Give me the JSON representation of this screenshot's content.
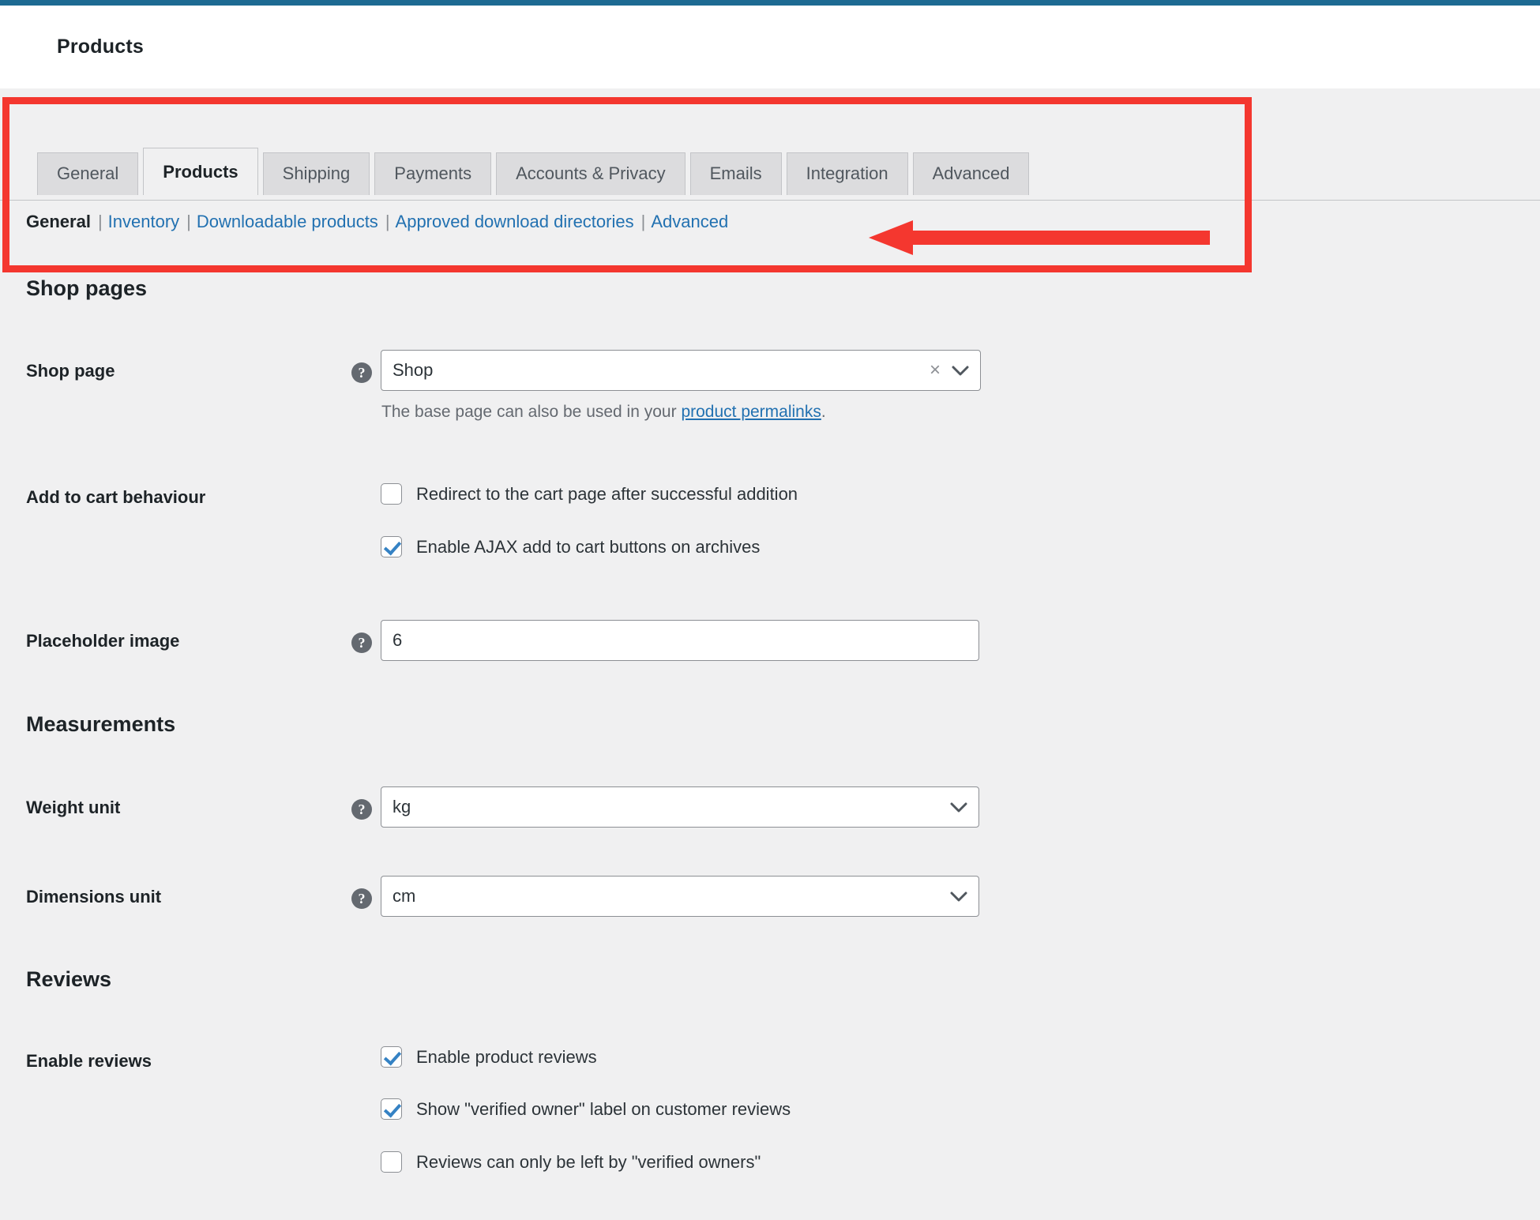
{
  "theme": {
    "accent_bar": "#1d6a92",
    "annotation_red": "#f4372f",
    "link_blue": "#2271b1",
    "checkbox_blue": "#3582c4",
    "body_bg": "#f0f0f1"
  },
  "header": {
    "title": "Products"
  },
  "tabs": [
    {
      "label": "General",
      "active": false
    },
    {
      "label": "Products",
      "active": true
    },
    {
      "label": "Shipping",
      "active": false
    },
    {
      "label": "Payments",
      "active": false
    },
    {
      "label": "Accounts & Privacy",
      "active": false
    },
    {
      "label": "Emails",
      "active": false
    },
    {
      "label": "Integration",
      "active": false
    },
    {
      "label": "Advanced",
      "active": false
    }
  ],
  "subnav": {
    "items": [
      {
        "label": "General",
        "current": true
      },
      {
        "label": "Inventory",
        "current": false
      },
      {
        "label": "Downloadable products",
        "current": false
      },
      {
        "label": "Approved download directories",
        "current": false
      },
      {
        "label": "Advanced",
        "current": false
      }
    ],
    "separator": "|"
  },
  "sections": {
    "shop_pages": {
      "heading": "Shop pages",
      "shop_page": {
        "label": "Shop page",
        "help": "?",
        "value": "Shop",
        "clear_icon": "×",
        "description_before": "The base page can also be used in your ",
        "description_link": "product permalinks",
        "description_after": "."
      },
      "add_to_cart": {
        "label": "Add to cart behaviour",
        "options": [
          {
            "label": "Redirect to the cart page after successful addition",
            "checked": false
          },
          {
            "label": "Enable AJAX add to cart buttons on archives",
            "checked": true
          }
        ]
      },
      "placeholder_image": {
        "label": "Placeholder image",
        "help": "?",
        "value": "6"
      }
    },
    "measurements": {
      "heading": "Measurements",
      "weight_unit": {
        "label": "Weight unit",
        "help": "?",
        "value": "kg"
      },
      "dimensions_unit": {
        "label": "Dimensions unit",
        "help": "?",
        "value": "cm"
      }
    },
    "reviews": {
      "heading": "Reviews",
      "enable_reviews": {
        "label": "Enable reviews",
        "options": [
          {
            "label": "Enable product reviews",
            "checked": true
          },
          {
            "label": "Show \"verified owner\" label on customer reviews",
            "checked": true
          },
          {
            "label": "Reviews can only be left by \"verified owners\"",
            "checked": false
          }
        ]
      }
    }
  }
}
